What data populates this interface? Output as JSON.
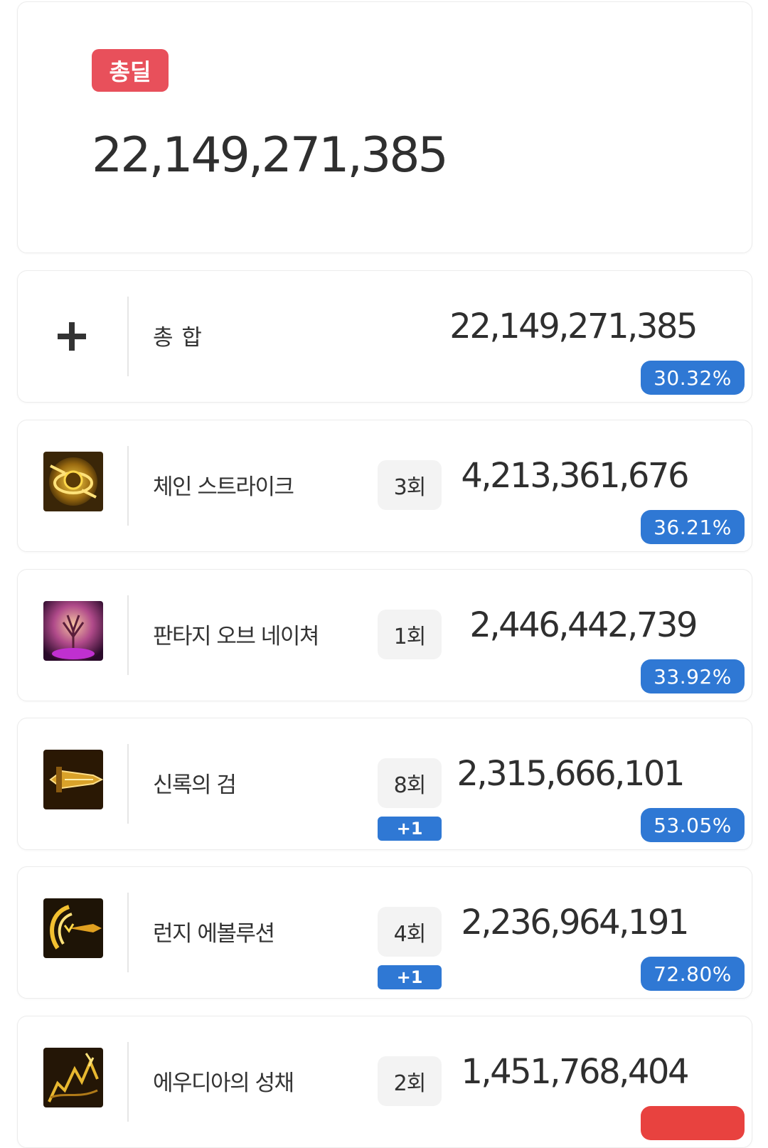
{
  "total": {
    "badge_label": "총딜",
    "value": "22,149,271,385"
  },
  "rows": [
    {
      "name": "총 합",
      "damage": "22,149,271,385",
      "percent": "30.32%"
    },
    {
      "name": "체인 스트라이크",
      "count": "3회",
      "damage": "4,213,361,676",
      "percent": "36.21%",
      "icon": "chain-strike-icon"
    },
    {
      "name": "판타지 오브 네이쳐",
      "count": "1회",
      "damage": "2,446,442,739",
      "percent": "33.92%",
      "icon": "fantasy-of-nature-icon"
    },
    {
      "name": "신록의 검",
      "count": "8회",
      "extra": "+1",
      "damage": "2,315,666,101",
      "percent": "53.05%",
      "icon": "verdant-sword-icon"
    },
    {
      "name": "런지 에볼루션",
      "count": "4회",
      "extra": "+1",
      "damage": "2,236,964,191",
      "percent": "72.80%",
      "icon": "lunge-evolution-icon"
    },
    {
      "name": "에우디아의 성채",
      "count": "2회",
      "damage": "1,451,768,404",
      "icon": "eudia-citadel-icon"
    }
  ],
  "colors": {
    "total_badge": "#e8505b",
    "percent_badge": "#2f78d4",
    "percent_badge_alt": "#e8423f"
  }
}
